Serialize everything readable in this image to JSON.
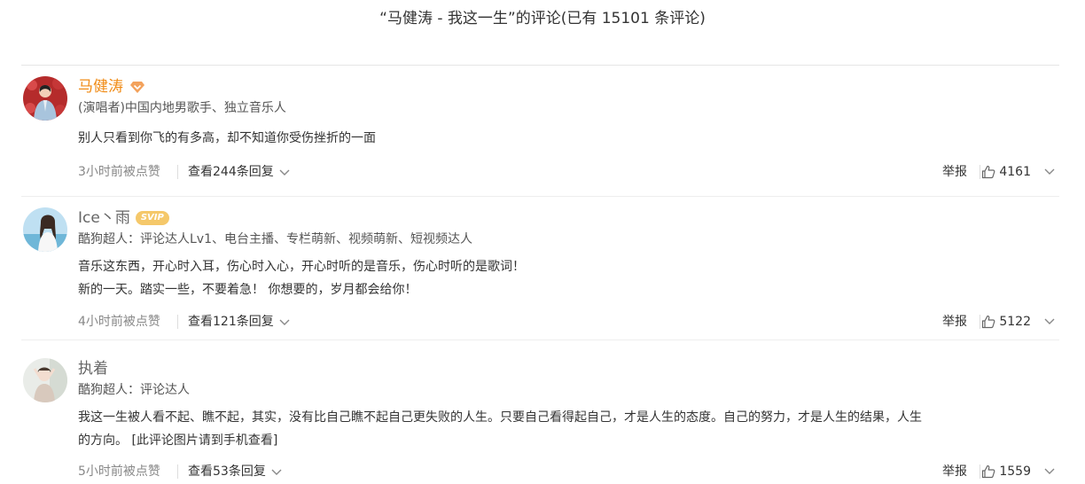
{
  "header": {
    "title": "“马健涛 - 我这一生”的评论(已有 15101 条评论)"
  },
  "comments": [
    {
      "name": "马健涛",
      "name_color": "#f08b16",
      "badge": "diamond-icon",
      "title": "(演唱者)中国内地男歌手、独立音乐人",
      "content": [
        "别人只看到你飞的有多高，却不知道你受伤挫折的一面"
      ],
      "time": "3小时前被点赞",
      "replies": "查看244条回复",
      "report": "举报",
      "likes": "4161"
    },
    {
      "name": "Ice丶雨",
      "name_color": "#666666",
      "badge": "SVIP",
      "badge_color": "#f5c86a",
      "title": "酷狗超人：评论达人Lv1、电台主播、专栏萌新、视频萌新、短视频达人",
      "content": [
        "音乐这东西，开心时入耳，伤心时入心，开心时听的是音乐，伤心时听的是歌词！",
        "新的一天。踏实一些，不要着急！ 你想要的，岁月都会给你！"
      ],
      "time": "4小时前被点赞",
      "replies": "查看121条回复",
      "report": "举报",
      "likes": "5122"
    },
    {
      "name": "执着",
      "name_color": "#666666",
      "badge": "",
      "title": "酷狗超人：评论达人",
      "content": [
        "我这一生被人看不起、瞧不起，其实，没有比自己瞧不起自己更失败的人生。只要自己看得起自己，才是人生的态度。自己的努力，才是人生的结果，人生",
        "的方向。 [此评论图片请到手机查看]"
      ],
      "time": "5小时前被点赞",
      "replies": "查看53条回复",
      "report": "举报",
      "likes": "1559"
    }
  ]
}
